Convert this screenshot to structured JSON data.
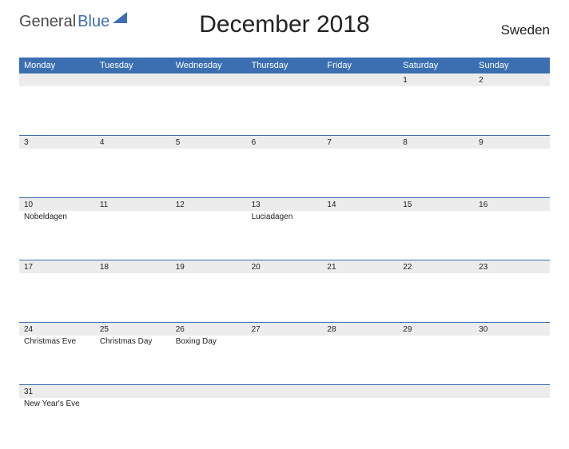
{
  "logo": {
    "part1": "General",
    "part2": "Blue"
  },
  "title": "December 2018",
  "country": "Sweden",
  "dayNames": [
    "Monday",
    "Tuesday",
    "Wednesday",
    "Thursday",
    "Friday",
    "Saturday",
    "Sunday"
  ],
  "weeks": [
    [
      {
        "date": "",
        "event": ""
      },
      {
        "date": "",
        "event": ""
      },
      {
        "date": "",
        "event": ""
      },
      {
        "date": "",
        "event": ""
      },
      {
        "date": "",
        "event": ""
      },
      {
        "date": "1",
        "event": ""
      },
      {
        "date": "2",
        "event": ""
      }
    ],
    [
      {
        "date": "3",
        "event": ""
      },
      {
        "date": "4",
        "event": ""
      },
      {
        "date": "5",
        "event": ""
      },
      {
        "date": "6",
        "event": ""
      },
      {
        "date": "7",
        "event": ""
      },
      {
        "date": "8",
        "event": ""
      },
      {
        "date": "9",
        "event": ""
      }
    ],
    [
      {
        "date": "10",
        "event": "Nobeldagen"
      },
      {
        "date": "11",
        "event": ""
      },
      {
        "date": "12",
        "event": ""
      },
      {
        "date": "13",
        "event": "Luciadagen"
      },
      {
        "date": "14",
        "event": ""
      },
      {
        "date": "15",
        "event": ""
      },
      {
        "date": "16",
        "event": ""
      }
    ],
    [
      {
        "date": "17",
        "event": ""
      },
      {
        "date": "18",
        "event": ""
      },
      {
        "date": "19",
        "event": ""
      },
      {
        "date": "20",
        "event": ""
      },
      {
        "date": "21",
        "event": ""
      },
      {
        "date": "22",
        "event": ""
      },
      {
        "date": "23",
        "event": ""
      }
    ],
    [
      {
        "date": "24",
        "event": "Christmas Eve"
      },
      {
        "date": "25",
        "event": "Christmas Day"
      },
      {
        "date": "26",
        "event": "Boxing Day"
      },
      {
        "date": "27",
        "event": ""
      },
      {
        "date": "28",
        "event": ""
      },
      {
        "date": "29",
        "event": ""
      },
      {
        "date": "30",
        "event": ""
      }
    ],
    [
      {
        "date": "31",
        "event": "New Year's Eve"
      },
      {
        "date": "",
        "event": ""
      },
      {
        "date": "",
        "event": ""
      },
      {
        "date": "",
        "event": ""
      },
      {
        "date": "",
        "event": ""
      },
      {
        "date": "",
        "event": ""
      },
      {
        "date": "",
        "event": ""
      }
    ]
  ]
}
